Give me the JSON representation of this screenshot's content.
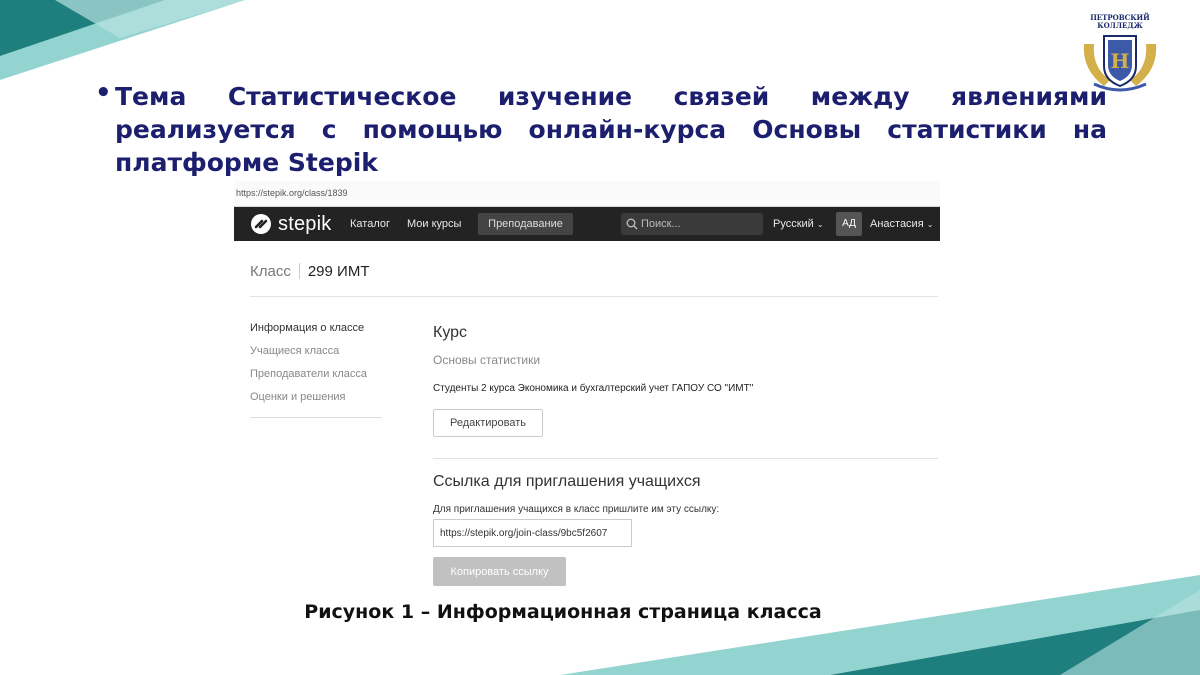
{
  "slide": {
    "bullet_text": "Тема Статистическое изучение связей между явлениями реализуется с помощью онлайн-курса Основы статистики на платформе Stepik",
    "caption": "Рисунок 1 – Информационная страница класса",
    "logo": {
      "line1": "ПЕТРОВСКИЙ",
      "line2": "КОЛЛЕДЖ",
      "icon": "college-crest-icon"
    },
    "colors": {
      "accent_dark_teal": "#1f7f7f",
      "accent_light_teal": "#6fc6c0",
      "title_navy": "#1b1f6e"
    }
  },
  "browser": {
    "url": "https://stepik.org/class/1839"
  },
  "topnav": {
    "brand": "stepik",
    "items": [
      "Каталог",
      "Мои курсы"
    ],
    "active_item": "Преподавание",
    "search_placeholder": "Поиск...",
    "language": "Русский",
    "avatar_initials": "АД",
    "user_name": "Анастасия"
  },
  "page": {
    "breadcrumb_label": "Класс",
    "class_name": "299 ИМТ",
    "sidebar": [
      {
        "label": "Информация о классе",
        "current": true
      },
      {
        "label": "Учащиеся класса",
        "current": false
      },
      {
        "label": "Преподаватели класса",
        "current": false
      },
      {
        "label": "Оценки и решения",
        "current": false
      }
    ],
    "course": {
      "heading": "Курс",
      "name": "Основы статистики",
      "description": "Студенты 2 курса Экономика и бухгалтерский учет ГАПОУ СО \"ИМТ\"",
      "edit_button": "Редактировать"
    },
    "invite": {
      "heading": "Ссылка для приглашения учащихся",
      "hint": "Для приглашения учащихся в класс пришлите им эту ссылку:",
      "link_value": "https://stepik.org/join-class/9bc5f2607",
      "copy_button": "Копировать ссылку"
    }
  }
}
